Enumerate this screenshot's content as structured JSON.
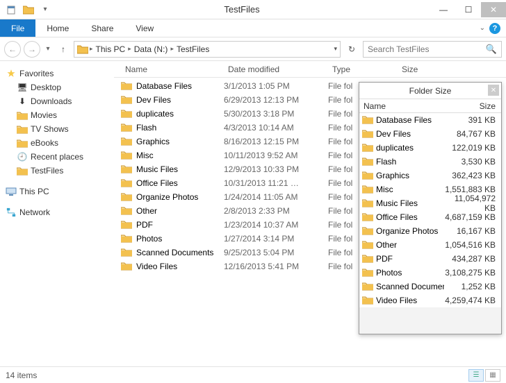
{
  "window": {
    "title": "TestFiles"
  },
  "ribbon": {
    "file": "File",
    "tabs": [
      "Home",
      "Share",
      "View"
    ]
  },
  "breadcrumb": {
    "items": [
      "This PC",
      "Data (N:)",
      "TestFiles"
    ]
  },
  "search": {
    "placeholder": "Search TestFiles"
  },
  "navpane": {
    "favorites": {
      "label": "Favorites",
      "items": [
        "Desktop",
        "Downloads",
        "Movies",
        "TV Shows",
        "eBooks",
        "Recent places",
        "TestFiles"
      ]
    },
    "thispc": "This PC",
    "network": "Network"
  },
  "columns": {
    "name": "Name",
    "date": "Date modified",
    "type": "Type",
    "size": "Size"
  },
  "files": [
    {
      "name": "Database Files",
      "date": "3/1/2013 1:05 PM",
      "type": "File fol"
    },
    {
      "name": "Dev Files",
      "date": "6/29/2013 12:13 PM",
      "type": "File fol"
    },
    {
      "name": "duplicates",
      "date": "5/30/2013 3:18 PM",
      "type": "File fol"
    },
    {
      "name": "Flash",
      "date": "4/3/2013 10:14 AM",
      "type": "File fol"
    },
    {
      "name": "Graphics",
      "date": "8/16/2013 12:15 PM",
      "type": "File fol"
    },
    {
      "name": "Misc",
      "date": "10/11/2013 9:52 AM",
      "type": "File fol"
    },
    {
      "name": "Music Files",
      "date": "12/9/2013 10:33 PM",
      "type": "File fol"
    },
    {
      "name": "Office Files",
      "date": "10/31/2013 11:21 …",
      "type": "File fol"
    },
    {
      "name": "Organize Photos",
      "date": "1/24/2014 11:05 AM",
      "type": "File fol"
    },
    {
      "name": "Other",
      "date": "2/8/2013 2:33 PM",
      "type": "File fol"
    },
    {
      "name": "PDF",
      "date": "1/23/2014 10:37 AM",
      "type": "File fol"
    },
    {
      "name": "Photos",
      "date": "1/27/2014 3:14 PM",
      "type": "File fol"
    },
    {
      "name": "Scanned Documents",
      "date": "9/25/2013 5:04 PM",
      "type": "File fol"
    },
    {
      "name": "Video Files",
      "date": "12/16/2013 5:41 PM",
      "type": "File fol"
    }
  ],
  "status": {
    "count": "14 items"
  },
  "popup": {
    "title": "Folder Size",
    "cols": {
      "name": "Name",
      "size": "Size"
    },
    "rows": [
      {
        "name": "Database Files",
        "size": "391 KB"
      },
      {
        "name": "Dev Files",
        "size": "84,767 KB"
      },
      {
        "name": "duplicates",
        "size": "122,019 KB"
      },
      {
        "name": "Flash",
        "size": "3,530 KB"
      },
      {
        "name": "Graphics",
        "size": "362,423 KB"
      },
      {
        "name": "Misc",
        "size": "1,551,883 KB"
      },
      {
        "name": "Music Files",
        "size": "11,054,972 KB"
      },
      {
        "name": "Office Files",
        "size": "4,687,159 KB"
      },
      {
        "name": "Organize Photos",
        "size": "16,167 KB"
      },
      {
        "name": "Other",
        "size": "1,054,516 KB"
      },
      {
        "name": "PDF",
        "size": "434,287 KB"
      },
      {
        "name": "Photos",
        "size": "3,108,275 KB"
      },
      {
        "name": "Scanned Documents",
        "size": "1,252 KB"
      },
      {
        "name": "Video Files",
        "size": "4,259,474 KB"
      }
    ]
  }
}
